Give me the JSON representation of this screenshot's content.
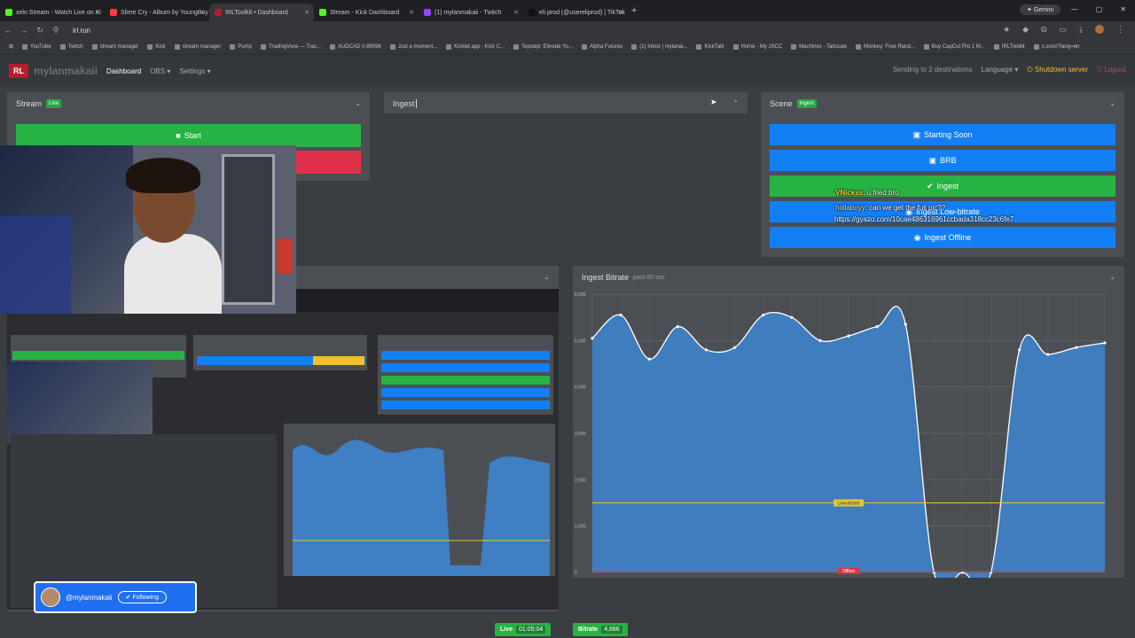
{
  "browser": {
    "tabs": [
      {
        "label": "xelo Stream - Watch Live on Ki",
        "color": "#53fc18",
        "active": false
      },
      {
        "label": "Slime Cry - Album by YoungBoy",
        "color": "#fc3c44",
        "active": false
      },
      {
        "label": "IRLToolkit • Dashboard",
        "color": "#b51f2a",
        "active": true
      },
      {
        "label": "Stream - Kick Dashboard",
        "color": "#53fc18",
        "active": false
      },
      {
        "label": "(1) mylanmakaii - Twitch",
        "color": "#9146ff",
        "active": false
      },
      {
        "label": "eli prod (@usereliprod) | TikTok",
        "color": "#111111",
        "active": false
      }
    ],
    "gemini_label": "Gemini",
    "url": "irl.run",
    "bookmarks": [
      "YouTube",
      "Twitch",
      "stream manager",
      "Kick",
      "stream manager",
      "Pump",
      "TradingView — Trac...",
      "AUDCAD 0.89596",
      "Just a moment...",
      "Kicklet.app - Kick C...",
      "Topstep: Elevate Yo...",
      "Alpha Futures",
      "(1) Inbox | mylanai...",
      "KickTalk",
      "Home - My JSCC",
      "Machines - Tailscale",
      "Monkey: Free Rand...",
      "Buy CapCut Pro 1 M...",
      "IRLToolkit",
      "x.com/?lang=en"
    ]
  },
  "nav": {
    "logo_mark": "RL",
    "brand": "mylanmakaii",
    "dashboard": "Dashboard",
    "obs": "OBS ▾",
    "settings": "Settings ▾",
    "destinations": "Sending to 2 destinations",
    "language": "Language ▾",
    "shutdown": "⏻ Shutdown server",
    "logout": "⎋ Logout"
  },
  "stream_card": {
    "title": "Stream",
    "badge": "Live",
    "start_label": "Start"
  },
  "ingest_card": {
    "input_value": "Ingest"
  },
  "scene_card": {
    "title": "Scene",
    "badge": "Ingest",
    "buttons": [
      {
        "label": "Starting Soon",
        "icon": "image-icon",
        "color": "#137ff5"
      },
      {
        "label": "BRB",
        "icon": "image-icon",
        "color": "#137ff5"
      },
      {
        "label": "Ingest",
        "icon": "check-icon",
        "color": "#27b343"
      },
      {
        "label": "Ingest Low-bitrate",
        "icon": "robot-icon",
        "color": "#137ff5"
      },
      {
        "label": "Ingest Offline",
        "icon": "robot-icon",
        "color": "#137ff5"
      }
    ]
  },
  "chat": [
    {
      "user": "VNickss",
      "text": ": u fried bro"
    },
    {
      "user": "hollaboyy",
      "text": ": can we get the full pic??"
    },
    {
      "user": "",
      "text": "https://gyazo.com/10cae486316961ccbada318cc23c6fe7"
    }
  ],
  "follow": {
    "handle": "@mylanmakaii",
    "button": "✔ Following"
  },
  "bottom_status": {
    "live_label": "Live",
    "live_time": "01:05:04",
    "bitrate_label": "Bitrate",
    "bitrate_value": "4,686"
  },
  "chart_data": {
    "type": "area",
    "title": "Ingest Bitrate",
    "subtitle": "past 60 sec",
    "ylim": [
      0,
      6000
    ],
    "yticks": [
      "0",
      "1,000",
      "2,000",
      "3,000",
      "4,000",
      "5,000",
      "6,000"
    ],
    "x": [
      0,
      1,
      2,
      3,
      4,
      5,
      6,
      7,
      8,
      9,
      10,
      11,
      12,
      13,
      14,
      15,
      16,
      17,
      18
    ],
    "values": [
      5050,
      5550,
      4600,
      5300,
      4800,
      4850,
      5550,
      5500,
      5000,
      5100,
      5300,
      5350,
      0,
      0,
      0,
      4800,
      4700,
      4850,
      4950
    ],
    "low_bitrate_line": 1500,
    "low_bitrate_label": "Low-bitrate",
    "offline_line": 0,
    "offline_label": "Offline",
    "fill_color": "#3f7fc4",
    "line_color": "#ffffff"
  }
}
